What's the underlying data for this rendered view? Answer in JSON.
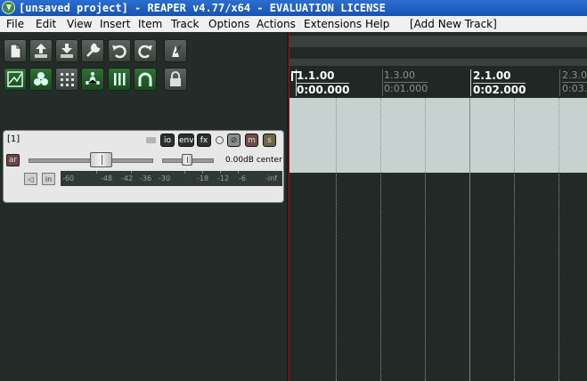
{
  "window": {
    "title": "[unsaved project] - REAPER v4.77/x64 - EVALUATION LICENSE"
  },
  "menu": {
    "file": "File",
    "edit": "Edit",
    "view": "View",
    "insert": "Insert",
    "item": "Item",
    "track": "Track",
    "options": "Options",
    "actions": "Actions",
    "extensions": "Extensions",
    "help": "Help",
    "add_new_track": "[Add New Track]"
  },
  "toolbar": {
    "row1_icons": [
      "new-project-icon",
      "open-project-icon",
      "save-project-icon",
      "preferences-wrench-icon",
      "undo-icon",
      "redo-icon",
      "metronome-icon"
    ],
    "row2_icons": [
      "item-grouping-icon",
      "snap-icon",
      "grid-icon",
      "ripple-edit-icon",
      "locking-icon",
      "auto-crossfade-icon",
      "lock-icon"
    ]
  },
  "track": {
    "number": "[1]",
    "buttons": {
      "io": "io",
      "env": "env",
      "fx": "fx",
      "mute": "m",
      "solo": "s",
      "arm": "ar"
    },
    "volume_readout": "0.00dB",
    "pan_readout": "center",
    "volume_db": 0.0,
    "meter_scale": [
      "-60",
      "-48",
      "-42",
      "-36",
      "-30",
      "-18",
      "-12",
      "-6",
      "-inf"
    ],
    "small_buttons": [
      "in"
    ]
  },
  "ruler": {
    "markers": [
      {
        "measure": "1.1.00",
        "time": "0:00.000",
        "major": true
      },
      {
        "measure": "1.3.00",
        "time": "0:01.000",
        "major": false
      },
      {
        "measure": "2.1.00",
        "time": "0:02.000",
        "major": true
      },
      {
        "measure": "2.3.0",
        "time": "0:03.",
        "major": false
      }
    ]
  },
  "colors": {
    "title_bar": "#1f5fc4",
    "panel_bg": "#242c29",
    "track_lane": "#c7d1d0",
    "cursor": "#7a2424"
  }
}
